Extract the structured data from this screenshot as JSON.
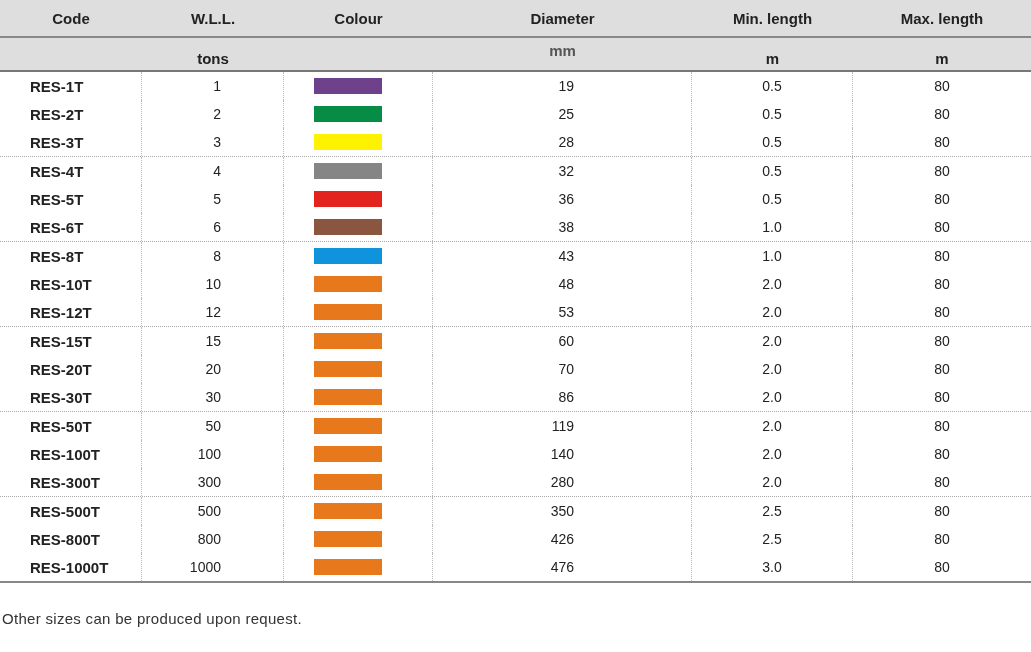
{
  "table": {
    "columns": [
      {
        "label": "Code"
      },
      {
        "label": "W.L.L.",
        "unit": "tons"
      },
      {
        "label": "Colour"
      },
      {
        "label": "Diameter",
        "unit": "mm"
      },
      {
        "label": "Min. length",
        "unit": "m"
      },
      {
        "label": "Max. length",
        "unit": "m"
      }
    ],
    "groups": [
      {
        "rows": [
          {
            "code": "RES-1T",
            "wll": "1",
            "color": "#6f418b",
            "diameter": "19",
            "min_length": "0.5",
            "max_length": "80"
          },
          {
            "code": "RES-2T",
            "wll": "2",
            "color": "#068c44",
            "diameter": "25",
            "min_length": "0.5",
            "max_length": "80"
          },
          {
            "code": "RES-3T",
            "wll": "3",
            "color": "#fff200",
            "diameter": "28",
            "min_length": "0.5",
            "max_length": "80"
          }
        ]
      },
      {
        "rows": [
          {
            "code": "RES-4T",
            "wll": "4",
            "color": "#858585",
            "diameter": "32",
            "min_length": "0.5",
            "max_length": "80"
          },
          {
            "code": "RES-5T",
            "wll": "5",
            "color": "#e2231e",
            "diameter": "36",
            "min_length": "0.5",
            "max_length": "80"
          },
          {
            "code": "RES-6T",
            "wll": "6",
            "color": "#8b5640",
            "diameter": "38",
            "min_length": "1.0",
            "max_length": "80"
          }
        ]
      },
      {
        "rows": [
          {
            "code": "RES-8T",
            "wll": "8",
            "color": "#0f93dc",
            "diameter": "43",
            "min_length": "1.0",
            "max_length": "80"
          },
          {
            "code": "RES-10T",
            "wll": "10",
            "color": "#e7781c",
            "diameter": "48",
            "min_length": "2.0",
            "max_length": "80"
          },
          {
            "code": "RES-12T",
            "wll": "12",
            "color": "#e7781c",
            "diameter": "53",
            "min_length": "2.0",
            "max_length": "80"
          }
        ]
      },
      {
        "rows": [
          {
            "code": "RES-15T",
            "wll": "15",
            "color": "#e7781c",
            "diameter": "60",
            "min_length": "2.0",
            "max_length": "80"
          },
          {
            "code": "RES-20T",
            "wll": "20",
            "color": "#e7781c",
            "diameter": "70",
            "min_length": "2.0",
            "max_length": "80"
          },
          {
            "code": "RES-30T",
            "wll": "30",
            "color": "#e7781c",
            "diameter": "86",
            "min_length": "2.0",
            "max_length": "80"
          }
        ]
      },
      {
        "rows": [
          {
            "code": "RES-50T",
            "wll": "50",
            "color": "#e7781c",
            "diameter": "119",
            "min_length": "2.0",
            "max_length": "80"
          },
          {
            "code": "RES-100T",
            "wll": "100",
            "color": "#e7781c",
            "diameter": "140",
            "min_length": "2.0",
            "max_length": "80"
          },
          {
            "code": "RES-300T",
            "wll": "300",
            "color": "#e7781c",
            "diameter": "280",
            "min_length": "2.0",
            "max_length": "80"
          }
        ]
      },
      {
        "rows": [
          {
            "code": "RES-500T",
            "wll": "500",
            "color": "#e7781c",
            "diameter": "350",
            "min_length": "2.5",
            "max_length": "80"
          },
          {
            "code": "RES-800T",
            "wll": "800",
            "color": "#e7781c",
            "diameter": "426",
            "min_length": "2.5",
            "max_length": "80"
          },
          {
            "code": "RES-1000T",
            "wll": "1000",
            "color": "#e7781c",
            "diameter": "476",
            "min_length": "3.0",
            "max_length": "80"
          }
        ]
      }
    ]
  },
  "note": "Other sizes can be produced upon request."
}
